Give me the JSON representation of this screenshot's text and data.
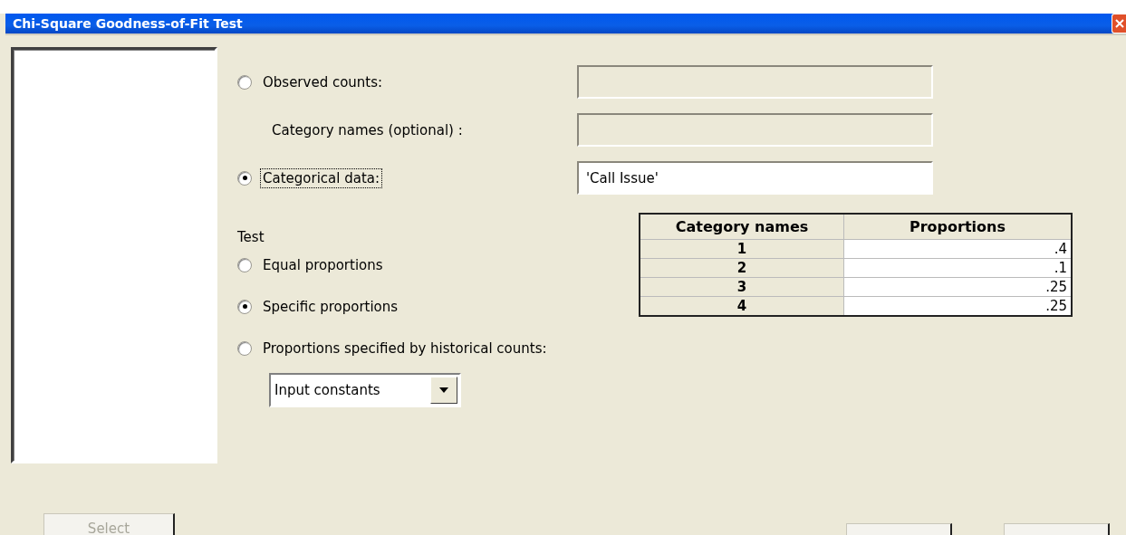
{
  "window": {
    "title": "Chi-Square Goodness-of-Fit Test"
  },
  "input_rows": [
    {
      "kind": "radio",
      "label": "Observed counts:",
      "selected": false,
      "focused": false,
      "field": {
        "disabled": true
      }
    },
    {
      "kind": "label",
      "label": "Category names (optional) :",
      "focused": false,
      "field": {
        "disabled": true
      }
    },
    {
      "kind": "radio",
      "label": "Categorical data:",
      "selected": true,
      "focused": true,
      "field": {
        "disabled": false,
        "value": "'Call Issue'"
      }
    }
  ],
  "test": {
    "label": "Test",
    "options": [
      {
        "label": "Equal proportions",
        "selected": false
      },
      {
        "label": "Specific proportions",
        "selected": true
      },
      {
        "label": "Proportions specified by historical counts:",
        "selected": false
      }
    ]
  },
  "dropdown": {
    "value": "Input constants"
  },
  "proportions_table": {
    "columns": [
      "Category names",
      "Proportions"
    ],
    "rows": [
      [
        "1",
        ".4"
      ],
      [
        "2",
        ".1"
      ],
      [
        "3",
        ".25"
      ],
      [
        "4",
        ".25"
      ]
    ]
  },
  "select_button": {
    "label": "Select",
    "disabled": true
  },
  "bottom_buttons": [
    {
      "disabled": false
    },
    {
      "disabled": false
    }
  ]
}
